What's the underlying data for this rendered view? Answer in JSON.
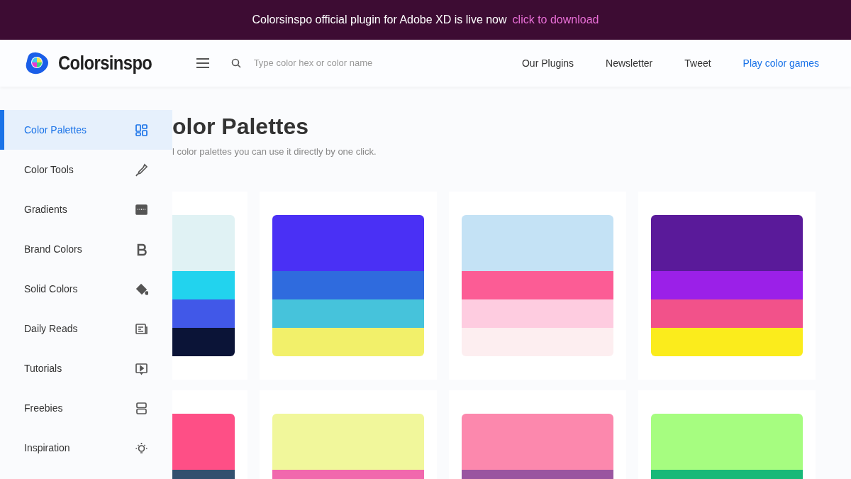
{
  "banner": {
    "text": "Colorsinspo official plugin for Adobe XD is live now",
    "link": "click to download"
  },
  "header": {
    "brand": "Colorsinspo",
    "search": {
      "placeholder": "Type color hex or color name"
    },
    "nav": [
      {
        "label": "Our Plugins",
        "highlighted": false
      },
      {
        "label": "Newsletter",
        "highlighted": false
      },
      {
        "label": "Tweet",
        "highlighted": false
      },
      {
        "label": "Play color games",
        "highlighted": true
      }
    ]
  },
  "sidebar": {
    "items": [
      {
        "label": "Color Palettes",
        "selected": true
      },
      {
        "label": "Color Tools",
        "selected": false
      },
      {
        "label": "Gradients",
        "selected": false
      },
      {
        "label": "Brand Colors",
        "selected": false
      },
      {
        "label": "Solid Colors",
        "selected": false
      },
      {
        "label": "Daily Reads",
        "selected": false
      },
      {
        "label": "Tutorials",
        "selected": false
      },
      {
        "label": "Freebies",
        "selected": false
      },
      {
        "label": "Inspiration",
        "selected": false
      }
    ]
  },
  "main": {
    "title": "olor Palettes",
    "subtitle": "l color palettes you can use it directly by one click.",
    "palettes": [
      {
        "swatches": [
          {
            "color": "#e0f2f4"
          },
          {
            "color": "#22d3ee"
          },
          {
            "color": "#4158e8"
          },
          {
            "color": "#0b1437"
          }
        ]
      },
      {
        "swatches": [
          {
            "color": "#4a30f5"
          },
          {
            "color": "#2f6bde"
          },
          {
            "color": "#46c3db"
          },
          {
            "color": "#f2f06a"
          }
        ]
      },
      {
        "swatches": [
          {
            "color": "#c4e2f5"
          },
          {
            "color": "#fc5c95"
          },
          {
            "color": "#fecce0"
          },
          {
            "color": "#fdeef0"
          }
        ]
      },
      {
        "swatches": [
          {
            "color": "#5a1a9a"
          },
          {
            "color": "#9b20e8"
          },
          {
            "color": "#f2528a"
          },
          {
            "color": "#fbec1c"
          }
        ]
      },
      {
        "swatches": [
          {
            "color": "#fe4f86"
          },
          {
            "color": "#33506e"
          }
        ]
      },
      {
        "swatches": [
          {
            "color": "#f1f79b"
          },
          {
            "color": "#f168ad"
          }
        ]
      },
      {
        "swatches": [
          {
            "color": "#fc88ad"
          },
          {
            "color": "#9a55a0"
          }
        ]
      },
      {
        "swatches": [
          {
            "color": "#a6fd80"
          },
          {
            "color": "#18b978"
          }
        ]
      }
    ]
  }
}
